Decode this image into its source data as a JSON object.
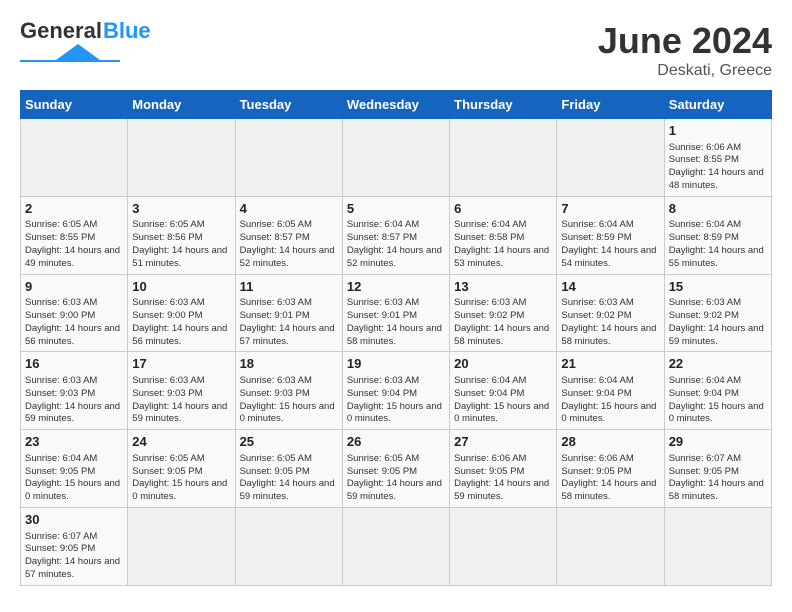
{
  "logo": {
    "text_general": "General",
    "text_blue": "Blue"
  },
  "title": {
    "month_year": "June 2024",
    "location": "Deskati, Greece"
  },
  "weekdays": [
    "Sunday",
    "Monday",
    "Tuesday",
    "Wednesday",
    "Thursday",
    "Friday",
    "Saturday"
  ],
  "weeks": [
    [
      {
        "day": "",
        "info": ""
      },
      {
        "day": "",
        "info": ""
      },
      {
        "day": "",
        "info": ""
      },
      {
        "day": "",
        "info": ""
      },
      {
        "day": "",
        "info": ""
      },
      {
        "day": "",
        "info": ""
      },
      {
        "day": "1",
        "info": "Sunrise: 6:06 AM\nSunset: 8:55 PM\nDaylight: 14 hours and 48 minutes."
      }
    ],
    [
      {
        "day": "2",
        "info": "Sunrise: 6:05 AM\nSunset: 8:55 PM\nDaylight: 14 hours and 49 minutes."
      },
      {
        "day": "3",
        "info": "Sunrise: 6:05 AM\nSunset: 8:56 PM\nDaylight: 14 hours and 51 minutes."
      },
      {
        "day": "4",
        "info": "Sunrise: 6:05 AM\nSunset: 8:57 PM\nDaylight: 14 hours and 52 minutes."
      },
      {
        "day": "5",
        "info": "Sunrise: 6:04 AM\nSunset: 8:57 PM\nDaylight: 14 hours and 52 minutes."
      },
      {
        "day": "6",
        "info": "Sunrise: 6:04 AM\nSunset: 8:58 PM\nDaylight: 14 hours and 53 minutes."
      },
      {
        "day": "7",
        "info": "Sunrise: 6:04 AM\nSunset: 8:59 PM\nDaylight: 14 hours and 54 minutes."
      },
      {
        "day": "8",
        "info": "Sunrise: 6:04 AM\nSunset: 8:59 PM\nDaylight: 14 hours and 55 minutes."
      }
    ],
    [
      {
        "day": "9",
        "info": "Sunrise: 6:03 AM\nSunset: 9:00 PM\nDaylight: 14 hours and 56 minutes."
      },
      {
        "day": "10",
        "info": "Sunrise: 6:03 AM\nSunset: 9:00 PM\nDaylight: 14 hours and 56 minutes."
      },
      {
        "day": "11",
        "info": "Sunrise: 6:03 AM\nSunset: 9:01 PM\nDaylight: 14 hours and 57 minutes."
      },
      {
        "day": "12",
        "info": "Sunrise: 6:03 AM\nSunset: 9:01 PM\nDaylight: 14 hours and 58 minutes."
      },
      {
        "day": "13",
        "info": "Sunrise: 6:03 AM\nSunset: 9:02 PM\nDaylight: 14 hours and 58 minutes."
      },
      {
        "day": "14",
        "info": "Sunrise: 6:03 AM\nSunset: 9:02 PM\nDaylight: 14 hours and 58 minutes."
      },
      {
        "day": "15",
        "info": "Sunrise: 6:03 AM\nSunset: 9:02 PM\nDaylight: 14 hours and 59 minutes."
      }
    ],
    [
      {
        "day": "16",
        "info": "Sunrise: 6:03 AM\nSunset: 9:03 PM\nDaylight: 14 hours and 59 minutes."
      },
      {
        "day": "17",
        "info": "Sunrise: 6:03 AM\nSunset: 9:03 PM\nDaylight: 14 hours and 59 minutes."
      },
      {
        "day": "18",
        "info": "Sunrise: 6:03 AM\nSunset: 9:03 PM\nDaylight: 15 hours and 0 minutes."
      },
      {
        "day": "19",
        "info": "Sunrise: 6:03 AM\nSunset: 9:04 PM\nDaylight: 15 hours and 0 minutes."
      },
      {
        "day": "20",
        "info": "Sunrise: 6:04 AM\nSunset: 9:04 PM\nDaylight: 15 hours and 0 minutes."
      },
      {
        "day": "21",
        "info": "Sunrise: 6:04 AM\nSunset: 9:04 PM\nDaylight: 15 hours and 0 minutes."
      },
      {
        "day": "22",
        "info": "Sunrise: 6:04 AM\nSunset: 9:04 PM\nDaylight: 15 hours and 0 minutes."
      }
    ],
    [
      {
        "day": "23",
        "info": "Sunrise: 6:04 AM\nSunset: 9:05 PM\nDaylight: 15 hours and 0 minutes."
      },
      {
        "day": "24",
        "info": "Sunrise: 6:05 AM\nSunset: 9:05 PM\nDaylight: 15 hours and 0 minutes."
      },
      {
        "day": "25",
        "info": "Sunrise: 6:05 AM\nSunset: 9:05 PM\nDaylight: 14 hours and 59 minutes."
      },
      {
        "day": "26",
        "info": "Sunrise: 6:05 AM\nSunset: 9:05 PM\nDaylight: 14 hours and 59 minutes."
      },
      {
        "day": "27",
        "info": "Sunrise: 6:06 AM\nSunset: 9:05 PM\nDaylight: 14 hours and 59 minutes."
      },
      {
        "day": "28",
        "info": "Sunrise: 6:06 AM\nSunset: 9:05 PM\nDaylight: 14 hours and 58 minutes."
      },
      {
        "day": "29",
        "info": "Sunrise: 6:07 AM\nSunset: 9:05 PM\nDaylight: 14 hours and 58 minutes."
      }
    ],
    [
      {
        "day": "30",
        "info": "Sunrise: 6:07 AM\nSunset: 9:05 PM\nDaylight: 14 hours and 57 minutes."
      },
      {
        "day": "",
        "info": ""
      },
      {
        "day": "",
        "info": ""
      },
      {
        "day": "",
        "info": ""
      },
      {
        "day": "",
        "info": ""
      },
      {
        "day": "",
        "info": ""
      },
      {
        "day": "",
        "info": ""
      }
    ]
  ]
}
